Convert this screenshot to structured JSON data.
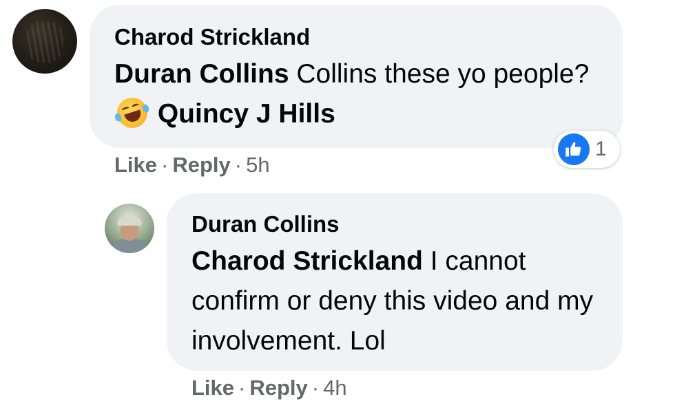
{
  "comments": [
    {
      "author": "Charod Strickland",
      "mention_1": "Duran Collins",
      "text_1": " Collins these yo people? ",
      "emoji": "rolling-on-floor-laughing-emoji",
      "mention_2": "Quincy J Hills",
      "like_label": "Like",
      "reply_label": "Reply",
      "timestamp": "5h",
      "reaction_count": "1",
      "reaction_type": "like"
    },
    {
      "author": "Duran Collins",
      "mention_1": "Charod Strickland",
      "text_1": " I cannot confirm or deny this video and my involvement. Lol",
      "like_label": "Like",
      "reply_label": "Reply",
      "timestamp": "4h"
    }
  ],
  "separator": "·",
  "colors": {
    "bubble": "#f0f2f5",
    "text": "#050505",
    "secondary_text": "#65676b",
    "like_blue": "#1877f2"
  }
}
